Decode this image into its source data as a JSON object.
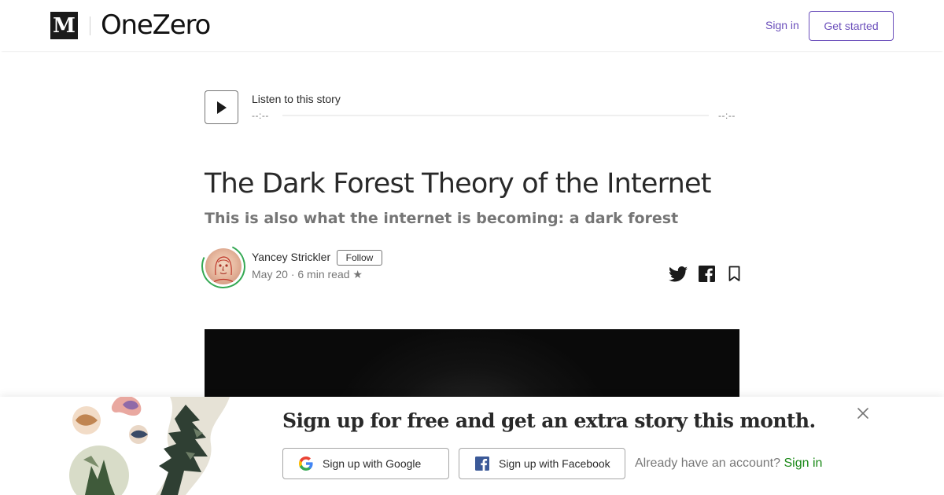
{
  "header": {
    "logo_letter": "M",
    "publication": "OneZero",
    "signin_label": "Sign in",
    "getstarted_label": "Get started",
    "accent_color": "#6b4fbb"
  },
  "player": {
    "listen_label": "Listen to this story",
    "time_elapsed": "--:--",
    "time_total": "--:--",
    "progress": 0
  },
  "article": {
    "title": "The Dark Forest Theory of the Internet",
    "subtitle": "This is also what the internet is becoming: a dark forest",
    "author": "Yancey Strickler",
    "follow_label": "Follow",
    "date": "May 20",
    "separator": "·",
    "read_time": "6 min read",
    "star": "★"
  },
  "share": {
    "icons": [
      "twitter-icon",
      "facebook-icon",
      "bookmark-icon"
    ]
  },
  "banner": {
    "headline": "Sign up for free and get an extra story this month.",
    "google_label": "Sign up with Google",
    "facebook_label": "Sign up with Facebook",
    "already_text": "Already have an account?",
    "signin_label": "Sign in",
    "signin_color": "#1a8917"
  }
}
